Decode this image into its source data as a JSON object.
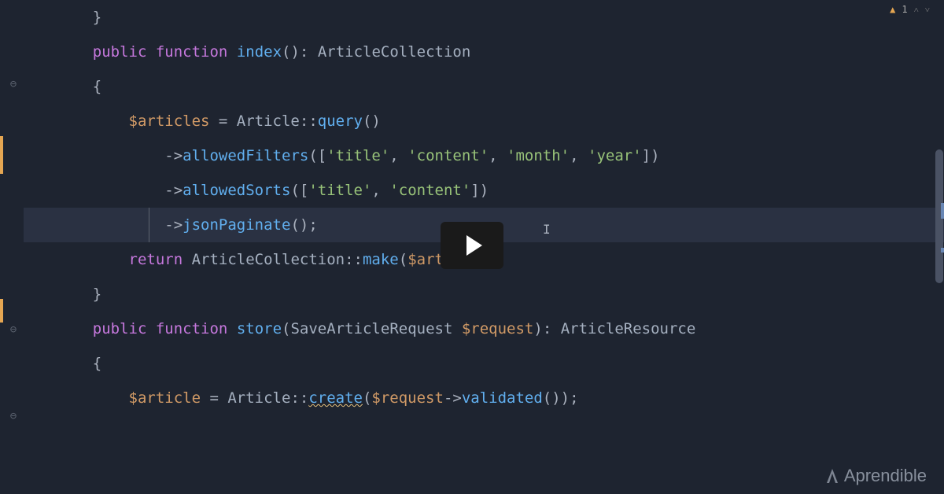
{
  "indicators": {
    "warning_count": "1",
    "nav_up": "˄",
    "nav_down": "˅"
  },
  "logo": {
    "text": "Aprendible"
  },
  "code": {
    "l0": "}",
    "l2_public": "public",
    "l2_function": "function",
    "l2_name": "index",
    "l2_parens": "()",
    "l2_colon": ":",
    "l2_type": "ArticleCollection",
    "l3": "{",
    "l4_var": "$articles",
    "l4_eq": " = ",
    "l4_class": "Article",
    "l4_scope": "::",
    "l4_method": "query",
    "l4_parens": "()",
    "l5_arrow": "->",
    "l5_method": "allowedFilters",
    "l5_open": "([",
    "l5_s1": "'title'",
    "l5_c1": ", ",
    "l5_s2": "'content'",
    "l5_c2": ", ",
    "l5_s3": "'month'",
    "l5_c3": ", ",
    "l5_s4": "'year'",
    "l5_close": "])",
    "l6_arrow": "->",
    "l6_method": "allowedSorts",
    "l6_open": "([",
    "l6_s1": "'title'",
    "l6_c1": ", ",
    "l6_s2": "'content'",
    "l6_close": "])",
    "l7_arrow": "->",
    "l7_method": "jsonPaginate",
    "l7_parens": "();",
    "l9_return": "return",
    "l9_class": "ArticleCollection",
    "l9_scope": "::",
    "l9_method": "make",
    "l9_open": "(",
    "l9_var": "$articles",
    "l9_close": ");",
    "l10": "}",
    "l12_public": "public",
    "l12_function": "function",
    "l12_name": "store",
    "l12_open": "(",
    "l12_ptype": "SaveArticleRequest",
    "l12_pvar": "$request",
    "l12_close": ")",
    "l12_colon": ":",
    "l12_rtype": "ArticleResource",
    "l13": "{",
    "l14_var": "$article",
    "l14_eq": " = ",
    "l14_class": "Article",
    "l14_scope": "::",
    "l14_method": "create",
    "l14_open": "(",
    "l14_pvar": "$request",
    "l14_arrow": "->",
    "l14_pmethod": "validated",
    "l14_close": "());"
  }
}
